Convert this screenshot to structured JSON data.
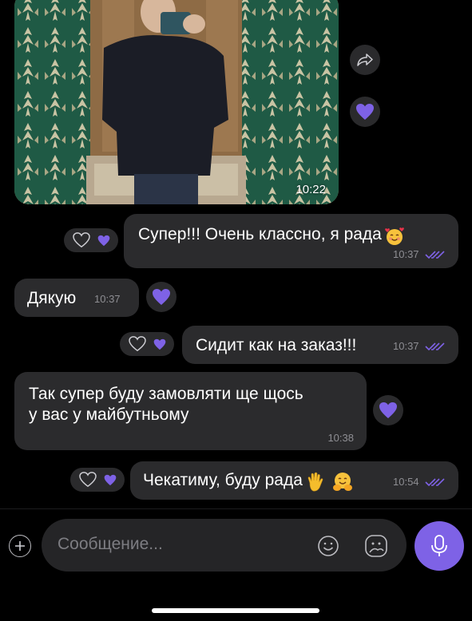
{
  "photo_message": {
    "time": "10:22"
  },
  "messages": [
    {
      "id": "m1",
      "direction": "outgoing",
      "text": "Супер!!! Очень классно, я рада",
      "emoji": "smiling-face-with-hearts",
      "time": "10:37",
      "status": "read"
    },
    {
      "id": "m2",
      "direction": "incoming",
      "text": "Дякую",
      "time": "10:37"
    },
    {
      "id": "m3",
      "direction": "outgoing",
      "text": "Сидит как на заказ!!!",
      "time": "10:37",
      "status": "read"
    },
    {
      "id": "m4",
      "direction": "incoming",
      "text_line1": "Так супер буду замовляти ще щось",
      "text_line2": "у вас у майбутньому",
      "time": "10:38"
    },
    {
      "id": "m5",
      "direction": "outgoing",
      "text": "Чекатиму, буду рада",
      "emojis": [
        "raised-hand",
        "hugging-face"
      ],
      "time": "10:54",
      "status": "read"
    }
  ],
  "composer": {
    "placeholder": "Сообщение..."
  },
  "icons": [
    "forward-icon",
    "heart-icon",
    "add-icon",
    "sticker-icon",
    "gallery-icon",
    "mic-icon",
    "read-ticks-icon"
  ],
  "colors": {
    "accent": "#7e62e6",
    "bubble": "#2b2b2d",
    "background": "#000000"
  }
}
